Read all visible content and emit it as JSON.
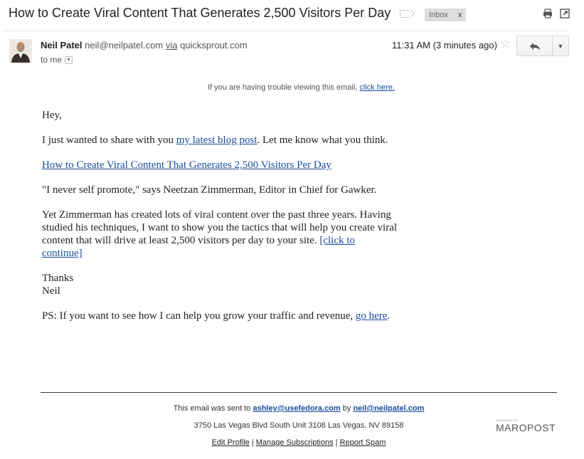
{
  "header": {
    "subject": "How to Create Viral Content That Generates 2,500 Visitors Per Day",
    "label": "Inbox",
    "label_close": "x"
  },
  "message": {
    "sender_name": "Neil Patel",
    "sender_email": "neil@neilpatel.com",
    "via_word": "via",
    "via_domain": "quicksprout.com",
    "to": "to me",
    "time": "11:31 AM (3 minutes ago)",
    "star": "☆"
  },
  "email": {
    "trouble_text": "If you are having trouble viewing this email,",
    "trouble_link": "click here.",
    "greeting": "Hey,",
    "line1_before": "I just wanted to share with you ",
    "line1_link": "my latest blog post",
    "line1_after": ". Let me know what you think.",
    "title_link": "How to Create Viral Content That Generates 2,500 Visitors Per Day",
    "quote": "\"I never self promote,\" says Neetzan Zimmerman, Editor in Chief for Gawker.",
    "para": "Yet Zimmerman has created lots of viral content over the past three years. Having studied his techniques, I want to show you the tactics that will help you create viral content that will drive at least 2,500 visitors per day to your site. ",
    "para_link": "[click to continue]",
    "thanks": "Thanks",
    "sign": "Neil",
    "ps_before": "PS: If you want to see how I can help you grow your traffic and revenue, ",
    "ps_link": "go here",
    "ps_after": "."
  },
  "footer": {
    "sent_prefix": "This email was sent to",
    "sent_to": "ashley@usefedora.com",
    "by_word": "by",
    "sent_by": "neil@neilpatel.com",
    "address": "3750 Las Vegas Blvd South Unit 3108 Las Vegas, NV 89158",
    "edit_profile": "Edit Profile",
    "sep": "|",
    "manage": "Manage Subscriptions",
    "report": "Report Spam",
    "logo_small": "POWERED BY",
    "logo_big": "MAROPOST"
  }
}
